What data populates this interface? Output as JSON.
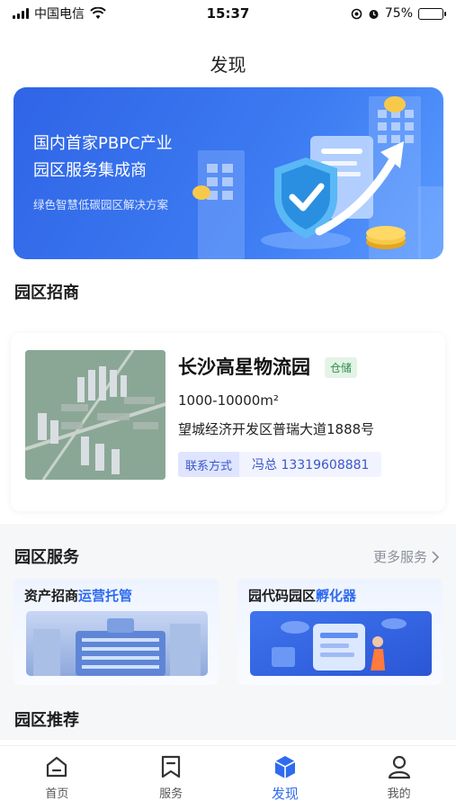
{
  "status_bar": {
    "carrier": "中国电信",
    "time": "15:37",
    "battery": "75%",
    "battery_level": 0.75
  },
  "header": {
    "title": "发现"
  },
  "banner": {
    "line1": "国内首家PBPC产业",
    "line2": "园区服务集成商",
    "subtitle": "绿色智慧低碳园区解决方案"
  },
  "sections": {
    "investment": "园区招商",
    "services": "园区服务",
    "recommend": "园区推荐",
    "more_services": "更多服务"
  },
  "park": {
    "name": "长沙高星物流园",
    "tag": "仓储",
    "area": "1000-10000m²",
    "address": "望城经济开发区普瑞大道1888号",
    "contact_label": "联系方式",
    "contact_value": "冯总 13319608881"
  },
  "services": [
    {
      "title_plain": "资产招商",
      "title_highlight": "运营托管"
    },
    {
      "title_plain": "园代码园区",
      "title_highlight": "孵化器"
    }
  ],
  "tabs": [
    {
      "label": "首页",
      "icon": "home-icon"
    },
    {
      "label": "服务",
      "icon": "bookmark-icon"
    },
    {
      "label": "发现",
      "icon": "cube-icon"
    },
    {
      "label": "我的",
      "icon": "user-icon"
    }
  ],
  "colors": {
    "accent": "#2f6bef",
    "banner_start": "#2f64e6",
    "tag_green": "#2e8b4a"
  }
}
